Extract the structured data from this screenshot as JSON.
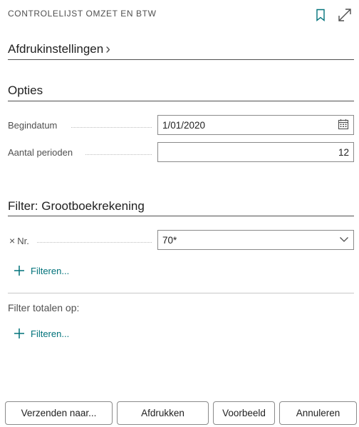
{
  "dialog": {
    "title": "CONTROLELIJST OMZET EN BTW",
    "bookmark_icon": "bookmark-icon",
    "expand_icon": "expand-icon"
  },
  "print_settings": {
    "label": "Afdrukinstellingen",
    "chevron": "›"
  },
  "options": {
    "title": "Opties",
    "start_date_label": "Begindatum",
    "start_date_value": "1/01/2020",
    "periods_label": "Aantal perioden",
    "periods_value": "12"
  },
  "filter": {
    "title": "Filter: Grootboekrekening",
    "remove_icon": "×",
    "nr_label": "Nr.",
    "nr_value": "70*",
    "add_filter_label": "Filteren...",
    "totals_label": "Filter totalen op:",
    "totals_add_filter_label": "Filteren..."
  },
  "buttons": {
    "send": "Verzenden naar...",
    "print": "Afdrukken",
    "preview": "Voorbeeld",
    "cancel": "Annuleren"
  },
  "colors": {
    "accent": "#00727a",
    "border": "#8a8a8a"
  }
}
